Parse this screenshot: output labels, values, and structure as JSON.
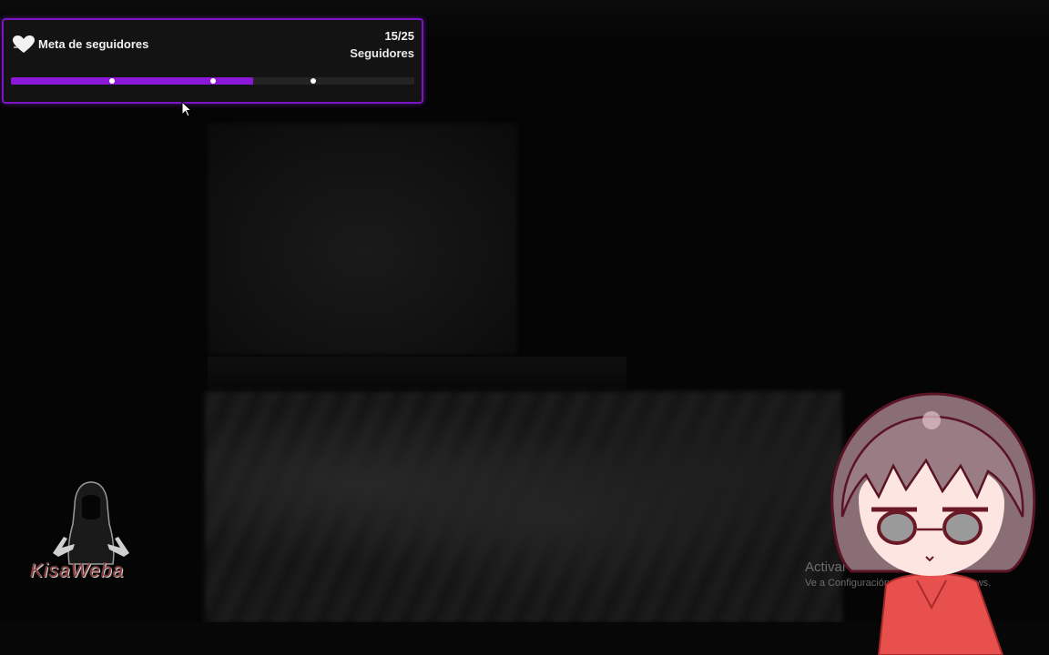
{
  "follower_goal": {
    "title": "Meta de seguidores",
    "count": "15/25",
    "unit": "Seguidores",
    "current": 15,
    "target": 25,
    "progress_fraction": 0.6,
    "milestones": [
      0.25,
      0.5,
      0.75
    ],
    "accent_color": "#8a18d6",
    "icon": "heart-icon"
  },
  "logo": {
    "text": "KisaWeba",
    "icon": "hooded-figure-icon"
  },
  "windows_watermark": {
    "title": "Activar Windows",
    "subtitle": "Ve a Configuración para activar Windows."
  },
  "cursor": {
    "icon": "arrow-cursor-icon"
  },
  "avatar": {
    "icon": "anime-character-avatar"
  }
}
